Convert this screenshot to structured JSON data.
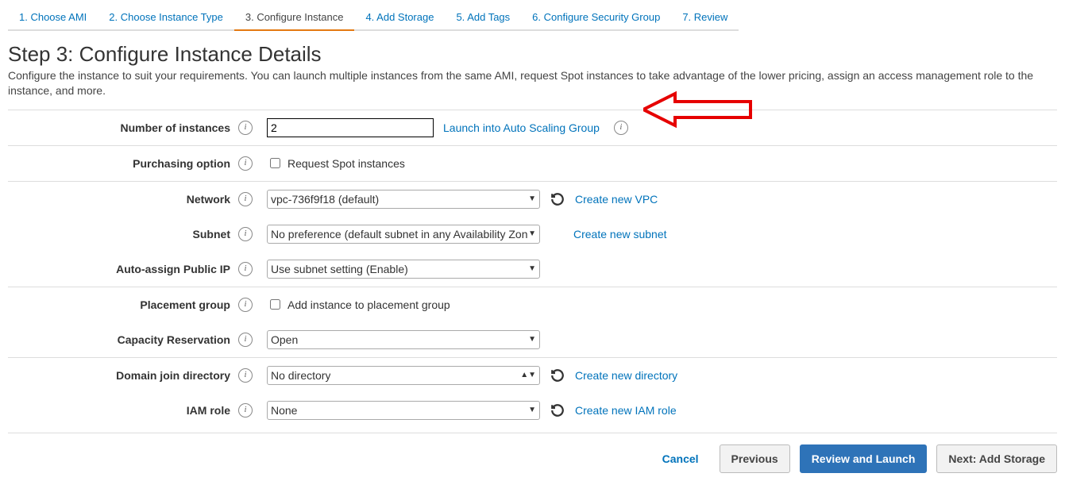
{
  "tabs": [
    "1. Choose AMI",
    "2. Choose Instance Type",
    "3. Configure Instance",
    "4. Add Storage",
    "5. Add Tags",
    "6. Configure Security Group",
    "7. Review"
  ],
  "active_tab_index": 2,
  "title": "Step 3: Configure Instance Details",
  "description": "Configure the instance to suit your requirements. You can launch multiple instances from the same AMI, request Spot instances to take advantage of the lower pricing, assign an access management role to the instance, and more.",
  "labels": {
    "num_instances": "Number of instances",
    "purchasing": "Purchasing option",
    "network": "Network",
    "subnet": "Subnet",
    "auto_ip": "Auto-assign Public IP",
    "placement": "Placement group",
    "capacity": "Capacity Reservation",
    "domain_dir": "Domain join directory",
    "iam": "IAM role"
  },
  "values": {
    "num_instances": "2",
    "launch_asg": "Launch into Auto Scaling Group",
    "spot_label": "Request Spot instances",
    "network": "vpc-736f9f18 (default)",
    "subnet": "No preference (default subnet in any Availability Zone)",
    "auto_ip": "Use subnet setting (Enable)",
    "placement_label": "Add instance to placement group",
    "capacity": "Open",
    "domain_dir": "No directory",
    "iam": "None"
  },
  "links": {
    "create_vpc": "Create new VPC",
    "create_subnet": "Create new subnet",
    "create_directory": "Create new directory",
    "create_iam": "Create new IAM role"
  },
  "footer": {
    "cancel": "Cancel",
    "previous": "Previous",
    "review": "Review and Launch",
    "next": "Next: Add Storage"
  }
}
